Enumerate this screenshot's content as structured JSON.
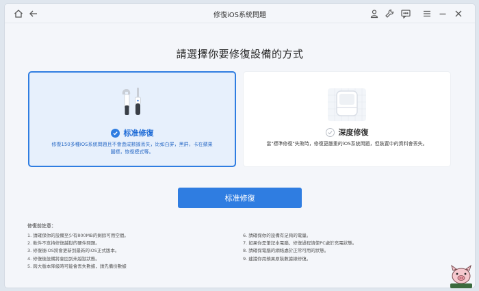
{
  "window": {
    "title": "修復iOS系統問題"
  },
  "heading": "請選擇你要修復設備的方式",
  "modes": [
    {
      "title": "标准修復",
      "description": "修復150多種iOS系統問題且不會造成數據丟失，比如白屏，黑屏，卡在蘋果圖標，恢復模式等。",
      "selected": true,
      "icon": "tools-icon"
    },
    {
      "title": "深度修復",
      "description": "當\"標準修復\"失敗時，修復更嚴重的iOS系統問題，但裝置中的資料會丟失。",
      "selected": false,
      "icon": "deep-repair-icon"
    }
  ],
  "primary_button": "标准修復",
  "notes": {
    "title": "修復前註意：",
    "left": [
      "1. 請確保你的設備至少有800MB的剩餘可用空間。",
      "2. 軟件不支持修復越獄的硬件問題。",
      "3. 修復後iOS將會更新到最新的iOS正式版本。",
      "4. 修復後設備將會回到未越獄狀態。",
      "5. 跨大版本降級時可能會丟失數據，請先備份數據"
    ],
    "right": [
      "6. 請確保你的設備有足夠的電量。",
      "7. 如果你是筆記本電腦，修復過程請使PC處於充電狀態。",
      "8. 請確保電腦的網絡處於正常可用的狀態。",
      "9. 建議你用蘋果原裝數據線修復。"
    ]
  },
  "colors": {
    "accent": "#2f7de1",
    "selected_bg": "#e7f0fc"
  }
}
